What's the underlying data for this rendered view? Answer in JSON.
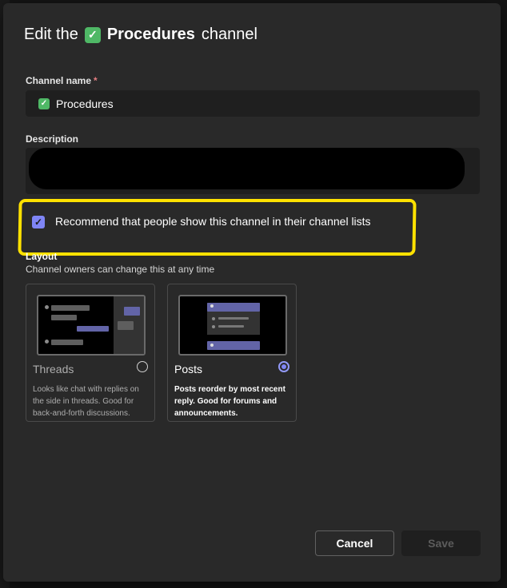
{
  "dialog": {
    "title_prefix": "Edit the",
    "title_emoji": "✓",
    "channel_name": "Procedures",
    "title_suffix": "channel"
  },
  "fields": {
    "channel_name_label": "Channel name",
    "required_mark": "*",
    "channel_name_value": "Procedures",
    "description_label": "Description"
  },
  "recommend": {
    "checked": true,
    "label": "Recommend that people show this channel in their channel lists"
  },
  "layout": {
    "heading": "Layout",
    "subheading": "Channel owners can change this at any time",
    "options": [
      {
        "title": "Threads",
        "description": "Looks like chat with replies on the side in threads. Good for back-and-forth discussions.",
        "selected": false
      },
      {
        "title": "Posts",
        "description": "Posts reorder by most recent reply. Good for forums and announcements.",
        "selected": true
      }
    ]
  },
  "buttons": {
    "cancel": "Cancel",
    "save": "Save"
  },
  "colors": {
    "accent": "#7f85f5",
    "highlight": "#ffe100",
    "emoji_green": "#4fb866"
  }
}
